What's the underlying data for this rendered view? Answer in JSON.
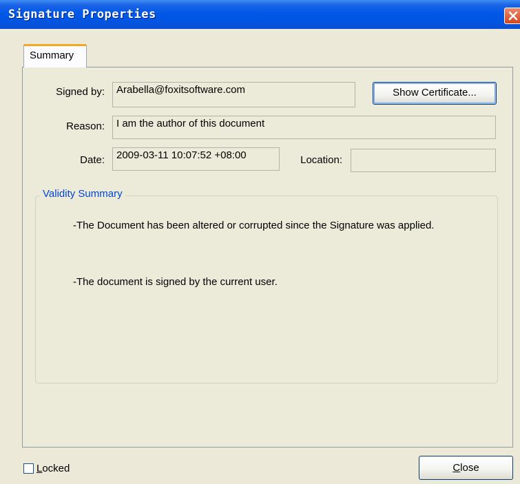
{
  "window": {
    "title": "Signature Properties"
  },
  "tabs": [
    {
      "label": "Summary",
      "active": true
    }
  ],
  "summary": {
    "signed_by_label": "Signed by:",
    "signed_by_value": "Arabella@foxitsoftware.com",
    "show_certificate_label": "Show Certificate...",
    "reason_label": "Reason:",
    "reason_value": "I am the author of this document",
    "date_label": "Date:",
    "date_value": "2009-03-11 10:07:52 +08:00",
    "location_label": "Location:",
    "location_value": ""
  },
  "validity": {
    "legend": "Validity Summary",
    "messages": [
      "-The Document has been altered or corrupted since the Signature was applied.",
      "-The document is signed by the current user."
    ]
  },
  "footer": {
    "locked_label": "Locked",
    "locked_checked": false,
    "close_label": "Close"
  },
  "icons": {
    "close": "close-icon"
  },
  "colors": {
    "titlebar": "#0058e6",
    "dialog_bg": "#ece9d8",
    "legend_text": "#0046d5",
    "close_button": "#d3461f"
  }
}
